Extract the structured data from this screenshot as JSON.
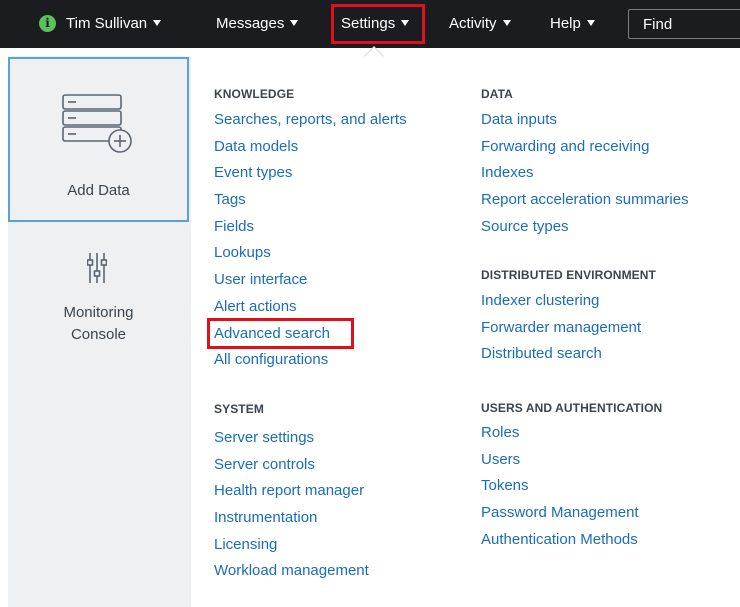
{
  "topbar": {
    "user_name": "Tim Sullivan",
    "messages_label": "Messages",
    "settings_label": "Settings",
    "activity_label": "Activity",
    "help_label": "Help",
    "find_placeholder": "Find",
    "info_icon_glyph": "i"
  },
  "sidebar": {
    "add_data_label": "Add Data",
    "monitoring_label_line1": "Monitoring",
    "monitoring_label_line2": "Console"
  },
  "menu": {
    "knowledge": {
      "heading": "KNOWLEDGE",
      "items": [
        "Searches, reports, and alerts",
        "Data models",
        "Event types",
        "Tags",
        "Fields",
        "Lookups",
        "User interface",
        "Alert actions",
        "Advanced search",
        "All configurations"
      ]
    },
    "system": {
      "heading": "SYSTEM",
      "items": [
        "Server settings",
        "Server controls",
        "Health report manager",
        "Instrumentation",
        "Licensing",
        "Workload management"
      ]
    },
    "data": {
      "heading": "DATA",
      "items": [
        "Data inputs",
        "Forwarding and receiving",
        "Indexes",
        "Report acceleration summaries",
        "Source types"
      ]
    },
    "distributed": {
      "heading": "DISTRIBUTED ENVIRONMENT",
      "items": [
        "Indexer clustering",
        "Forwarder management",
        "Distributed search"
      ]
    },
    "users": {
      "heading": "USERS AND AUTHENTICATION",
      "items": [
        "Roles",
        "Users",
        "Tokens",
        "Password Management",
        "Authentication Methods"
      ]
    }
  },
  "colors": {
    "topbar_bg": "#1a1c20",
    "link": "#1a6db8",
    "highlight_border": "#e0101b",
    "info_icon": "#5cc05c",
    "selected_card_border": "#5aa0d9"
  },
  "icons": [
    "info-icon",
    "caret-down-icon",
    "add-data-icon",
    "monitoring-console-icon"
  ]
}
